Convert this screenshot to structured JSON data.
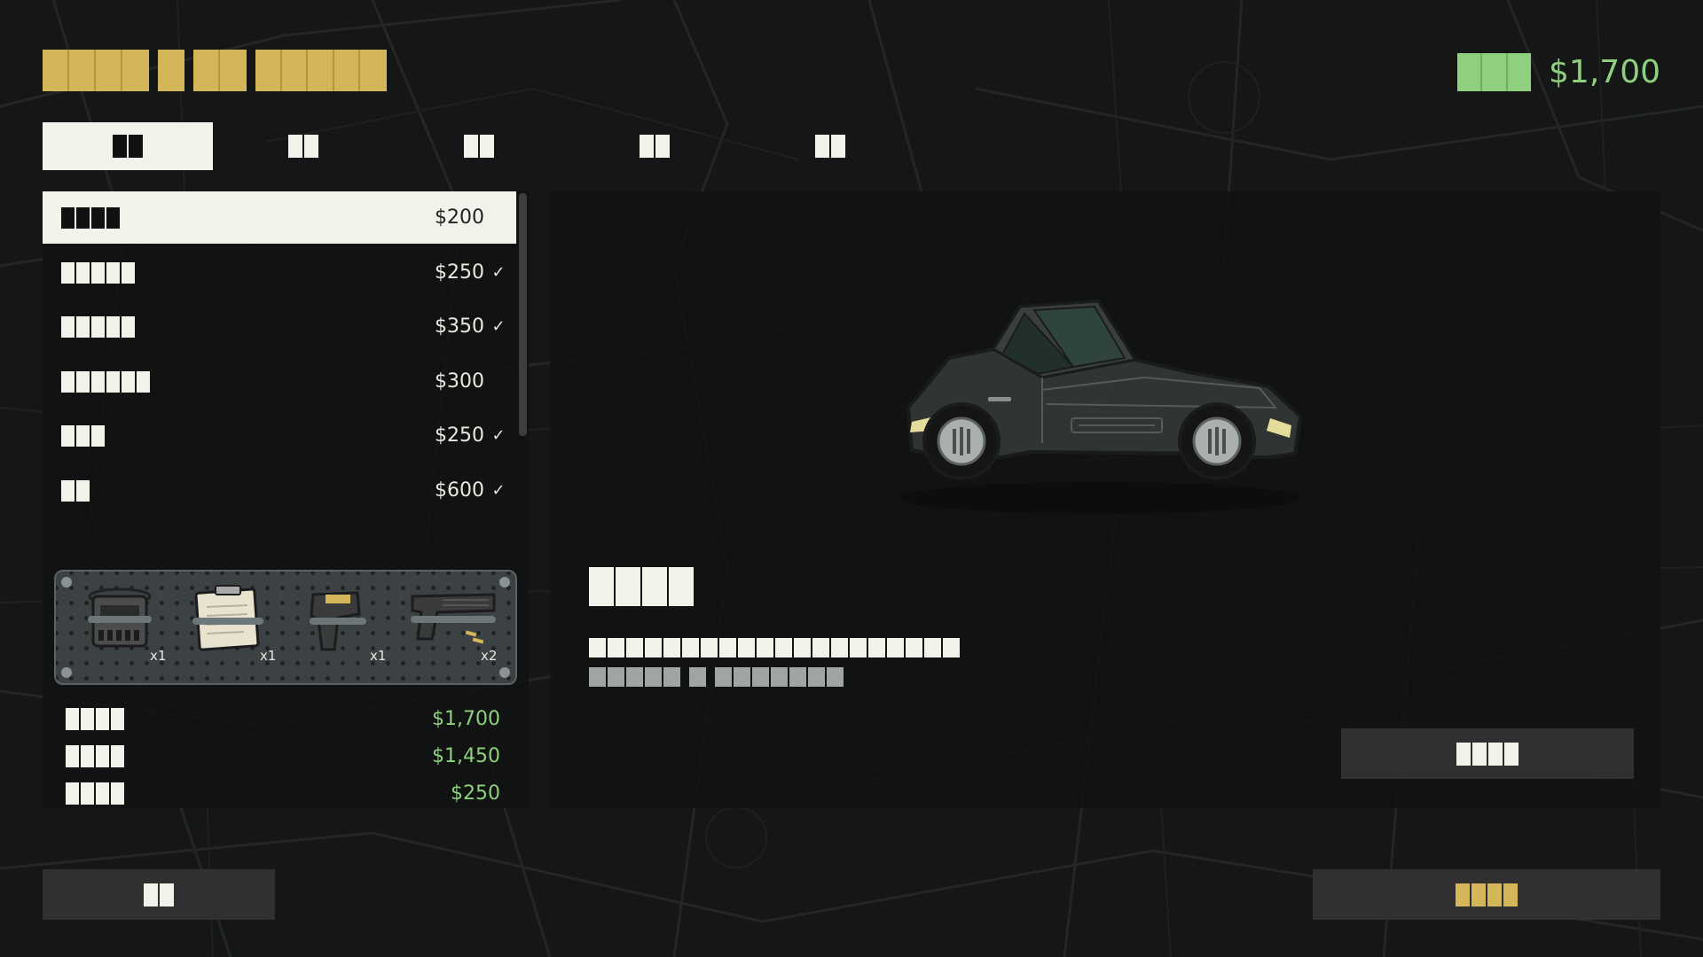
{
  "header": {
    "money": "$1,700"
  },
  "tabs": [
    {
      "label": "",
      "active": true
    },
    {
      "label": "",
      "active": false
    },
    {
      "label": "",
      "active": false
    },
    {
      "label": "",
      "active": false
    },
    {
      "label": "",
      "active": false
    }
  ],
  "items": [
    {
      "price": "$200",
      "owned": false,
      "selected": true
    },
    {
      "price": "$250",
      "owned": true,
      "selected": false
    },
    {
      "price": "$350",
      "owned": true,
      "selected": false
    },
    {
      "price": "$300",
      "owned": false,
      "selected": false
    },
    {
      "price": "$250",
      "owned": true,
      "selected": false
    },
    {
      "price": "$600",
      "owned": true,
      "selected": false
    }
  ],
  "check_mark": "✓",
  "loadout": [
    {
      "icon": "radio-icon",
      "qty": "x1"
    },
    {
      "icon": "clipboard-icon",
      "qty": "x1"
    },
    {
      "icon": "taser-icon",
      "qty": "x1"
    },
    {
      "icon": "pistol-icon",
      "qty": "x2"
    }
  ],
  "totals": [
    {
      "value": "$1,700"
    },
    {
      "value": "$1,450"
    },
    {
      "value": "$250"
    }
  ],
  "colors": {
    "accent_gold": "#d4b659",
    "money_green": "#8ed07e",
    "panel_bg": "#111312",
    "selected_bg": "#f2f1ea"
  }
}
